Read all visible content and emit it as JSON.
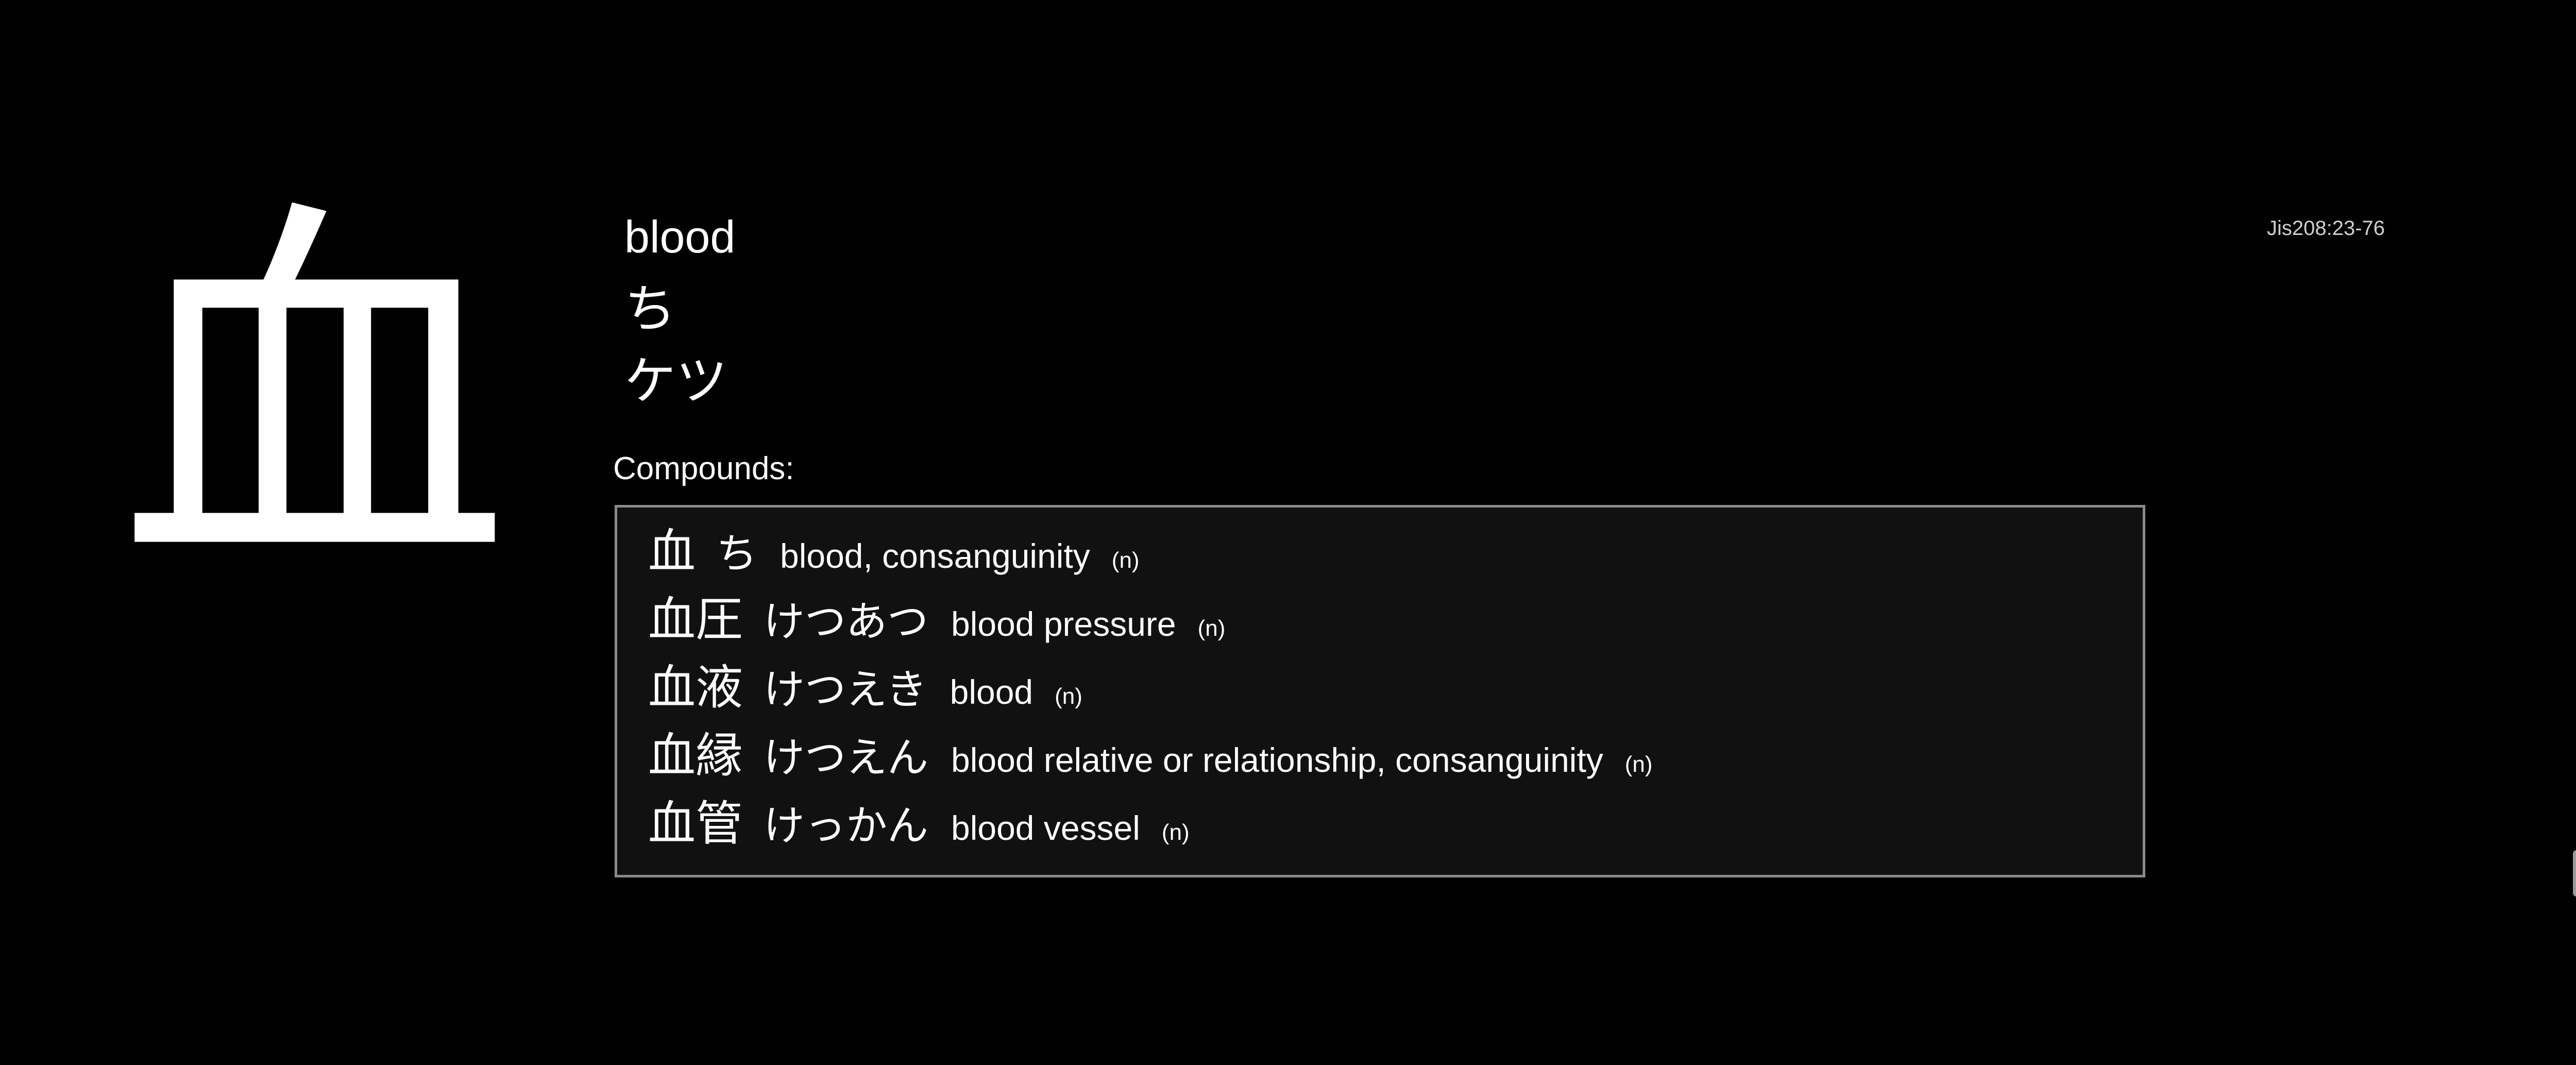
{
  "kanji": {
    "character": "血",
    "meaning": "blood",
    "kun_reading": "ち",
    "on_reading": "ケツ",
    "jis_code": "Jis208:23-76"
  },
  "compounds": {
    "label": "Compounds:",
    "items": [
      {
        "word": "血",
        "reading": "ち",
        "definition": "blood, consanguinity",
        "pos": "(n)"
      },
      {
        "word": "血圧",
        "reading": "けつあつ",
        "definition": "blood pressure",
        "pos": "(n)"
      },
      {
        "word": "血液",
        "reading": "けつえき",
        "definition": "blood",
        "pos": "(n)"
      },
      {
        "word": "血縁",
        "reading": "けつえん",
        "definition": "blood relative or relationship, consanguinity",
        "pos": "(n)"
      },
      {
        "word": "血管",
        "reading": "けっかん",
        "definition": "blood vessel",
        "pos": "(n)"
      }
    ]
  },
  "colors": {
    "background": "#000000",
    "text": "#ffffff",
    "box_background": "#111111",
    "box_border": "#8a8a8a"
  }
}
